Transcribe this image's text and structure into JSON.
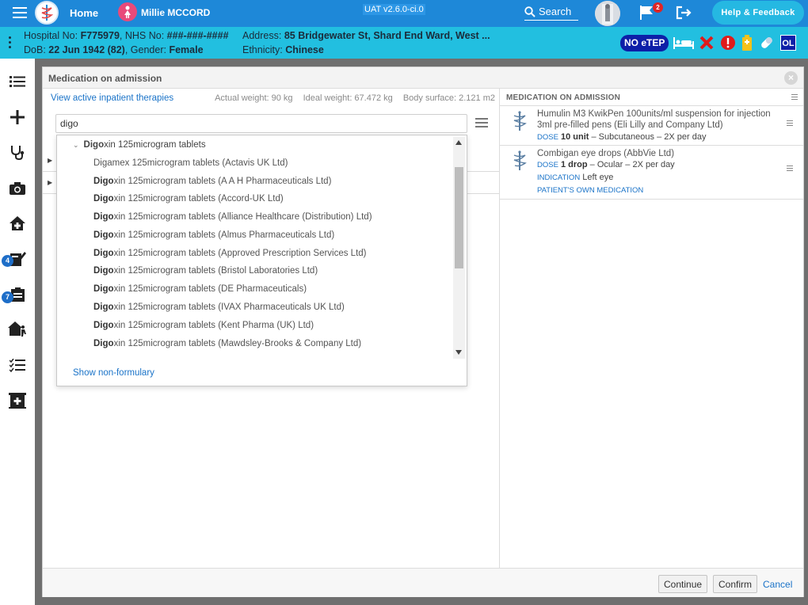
{
  "topbar": {
    "home_label": "Home",
    "patient_name": "Millie MCCORD",
    "version": "UAT v2.6.0-ci.0",
    "search_label": "Search",
    "flag_count": "2",
    "help_label": "Help & Feedback"
  },
  "banner": {
    "hospital_label": "Hospital No: ",
    "hospital_no": "F775979",
    "nhs_label": ", NHS No: ",
    "nhs_no": "###-###-####",
    "address_label": "Address: ",
    "address": "85 Bridgewater St, Shard End Ward, West ...",
    "dob_label": "DoB: ",
    "dob": "22 Jun 1942 (82)",
    "gender_label": ", Gender: ",
    "gender": "Female",
    "ethnicity_label": "Ethnicity: ",
    "ethnicity": "Chinese",
    "no_etep": "NO eTEP",
    "ol": "OL"
  },
  "sidebar": {
    "badge_notes": "4",
    "badge_tasks": "7"
  },
  "modal": {
    "title": "Medication on admission",
    "view_link": "View active inpatient therapies",
    "actual_weight": "Actual weight: 90 kg",
    "ideal_weight": "Ideal weight: 67.472 kg",
    "body_surface": "Body surface: 2.121 m2",
    "search_value": "digo",
    "dropdown": {
      "parent": {
        "match": "Digo",
        "rest": "xin 125microgram tablets"
      },
      "items": [
        {
          "match": "",
          "rest": "Digamex 125microgram tablets (Actavis UK Ltd)"
        },
        {
          "match": "Digo",
          "rest": "xin 125microgram tablets (A A H Pharmaceuticals Ltd)"
        },
        {
          "match": "Digo",
          "rest": "xin 125microgram tablets (Accord-UK Ltd)"
        },
        {
          "match": "Digo",
          "rest": "xin 125microgram tablets (Alliance Healthcare (Distribution) Ltd)"
        },
        {
          "match": "Digo",
          "rest": "xin 125microgram tablets (Almus Pharmaceuticals Ltd)"
        },
        {
          "match": "Digo",
          "rest": "xin 125microgram tablets (Approved Prescription Services Ltd)"
        },
        {
          "match": "Digo",
          "rest": "xin 125microgram tablets (Bristol Laboratories Ltd)"
        },
        {
          "match": "Digo",
          "rest": "xin 125microgram tablets (DE Pharmaceuticals)"
        },
        {
          "match": "Digo",
          "rest": "xin 125microgram tablets (IVAX Pharmaceuticals UK Ltd)"
        },
        {
          "match": "Digo",
          "rest": "xin 125microgram tablets (Kent Pharma (UK) Ltd)"
        },
        {
          "match": "Digo",
          "rest": "xin 125microgram tablets (Mawdsley-Brooks & Company Ltd)"
        }
      ],
      "show_nonformulary": "Show non-formulary"
    },
    "right_title": "MEDICATION ON ADMISSION",
    "meds": [
      {
        "name": "Humulin M3 KwikPen 100units/ml suspension for injection 3ml pre-filled pens (Eli Lilly and Company Ltd)",
        "dose_label": "DOSE",
        "dose_value": "10 unit",
        "dose_rest": " – Subcutaneous – 2X per day"
      },
      {
        "name": "Combigan eye drops (AbbVie Ltd)",
        "dose_label": "DOSE",
        "dose_value": "1 drop",
        "dose_rest": " – Ocular – 2X per day",
        "indication_label": "INDICATION",
        "indication_value": "Left eye",
        "pom_label": "PATIENT'S OWN MEDICATION"
      }
    ],
    "footer": {
      "continue_label": "Continue",
      "confirm_label": "Confirm",
      "cancel_label": "Cancel"
    }
  },
  "colors": {
    "topbar": "#1e88d8",
    "banner": "#22bfe0",
    "help": "#25b8e2",
    "link": "#1a73c8",
    "badge_blue": "#0d1fa8"
  }
}
